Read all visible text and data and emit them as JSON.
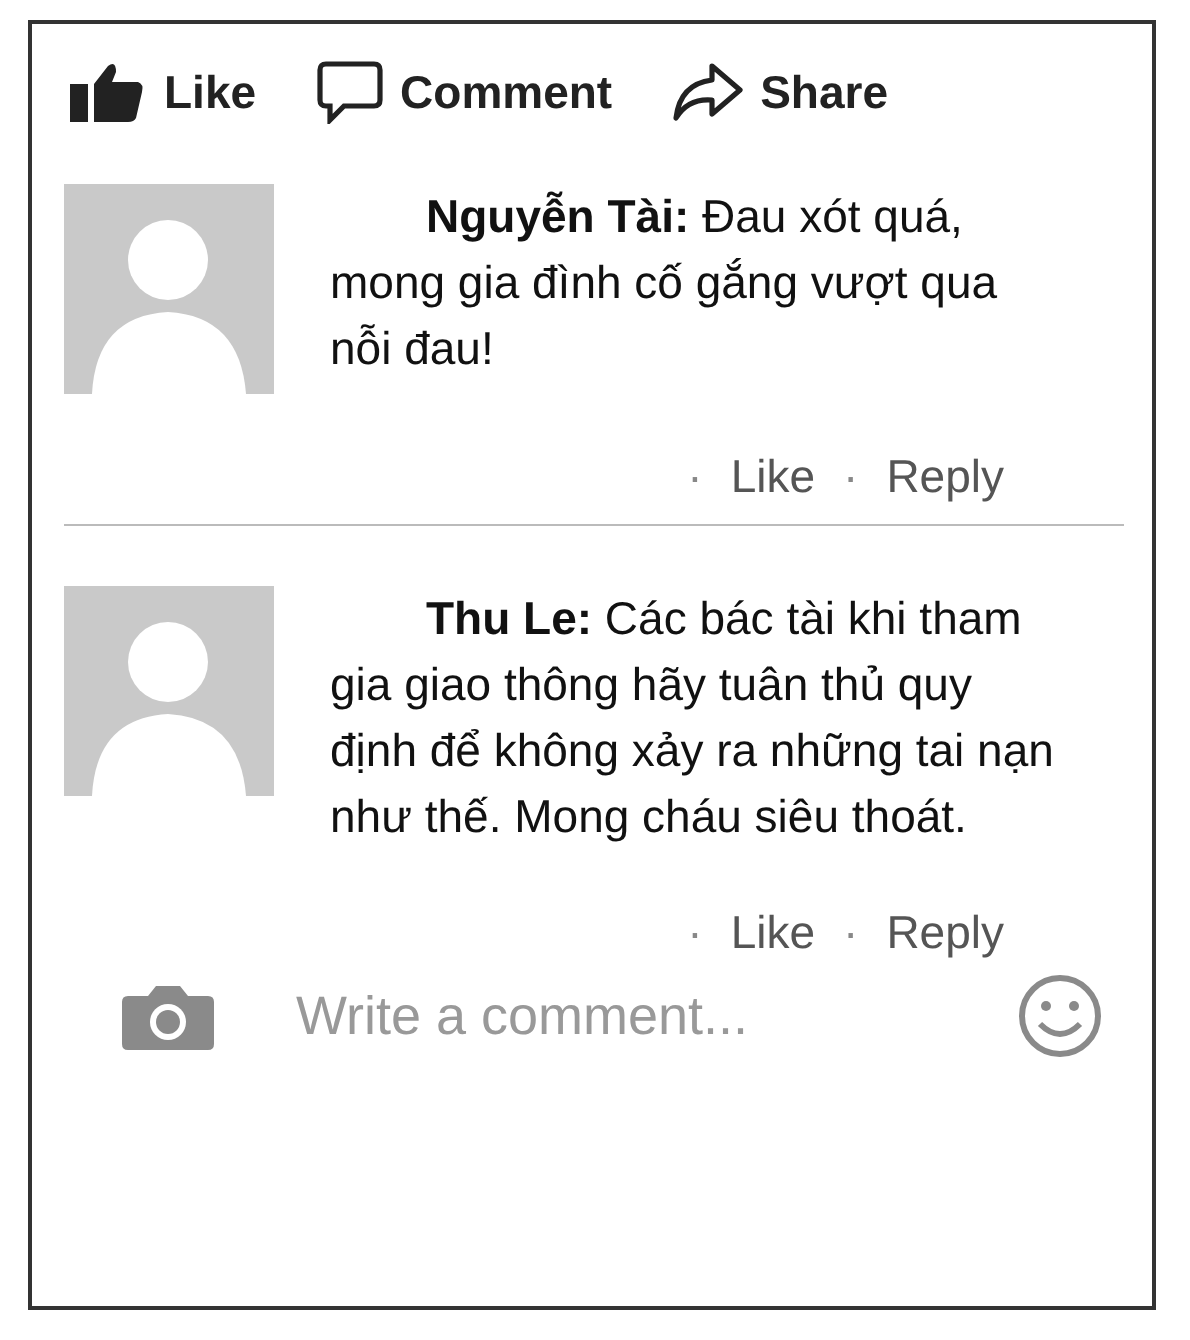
{
  "actions": [
    {
      "kind": "like",
      "label": "Like"
    },
    {
      "kind": "comment",
      "label": "Comment"
    },
    {
      "kind": "share",
      "label": "Share"
    }
  ],
  "comments": [
    {
      "text": "**Nguyễn Tài:** Đau xót quá, mong gia đình cố gắng vượt qua nỗi đau!",
      "links": [
        {
          "bullet": "·",
          "label": "Like"
        },
        {
          "bullet": "·",
          "label": "Reply"
        }
      ]
    },
    {
      "text": "**Thu Le:** Các bác tài khi tham gia giao thông hãy tuân thủ quy định để không xảy ra những tai nạn như thế. Mong cháu siêu thoát.",
      "links": [
        {
          "bullet": "·",
          "label": "Like"
        },
        {
          "bullet": "·",
          "label": "Reply"
        }
      ]
    }
  ],
  "composer": {
    "placeholder": "Write a comment..."
  }
}
